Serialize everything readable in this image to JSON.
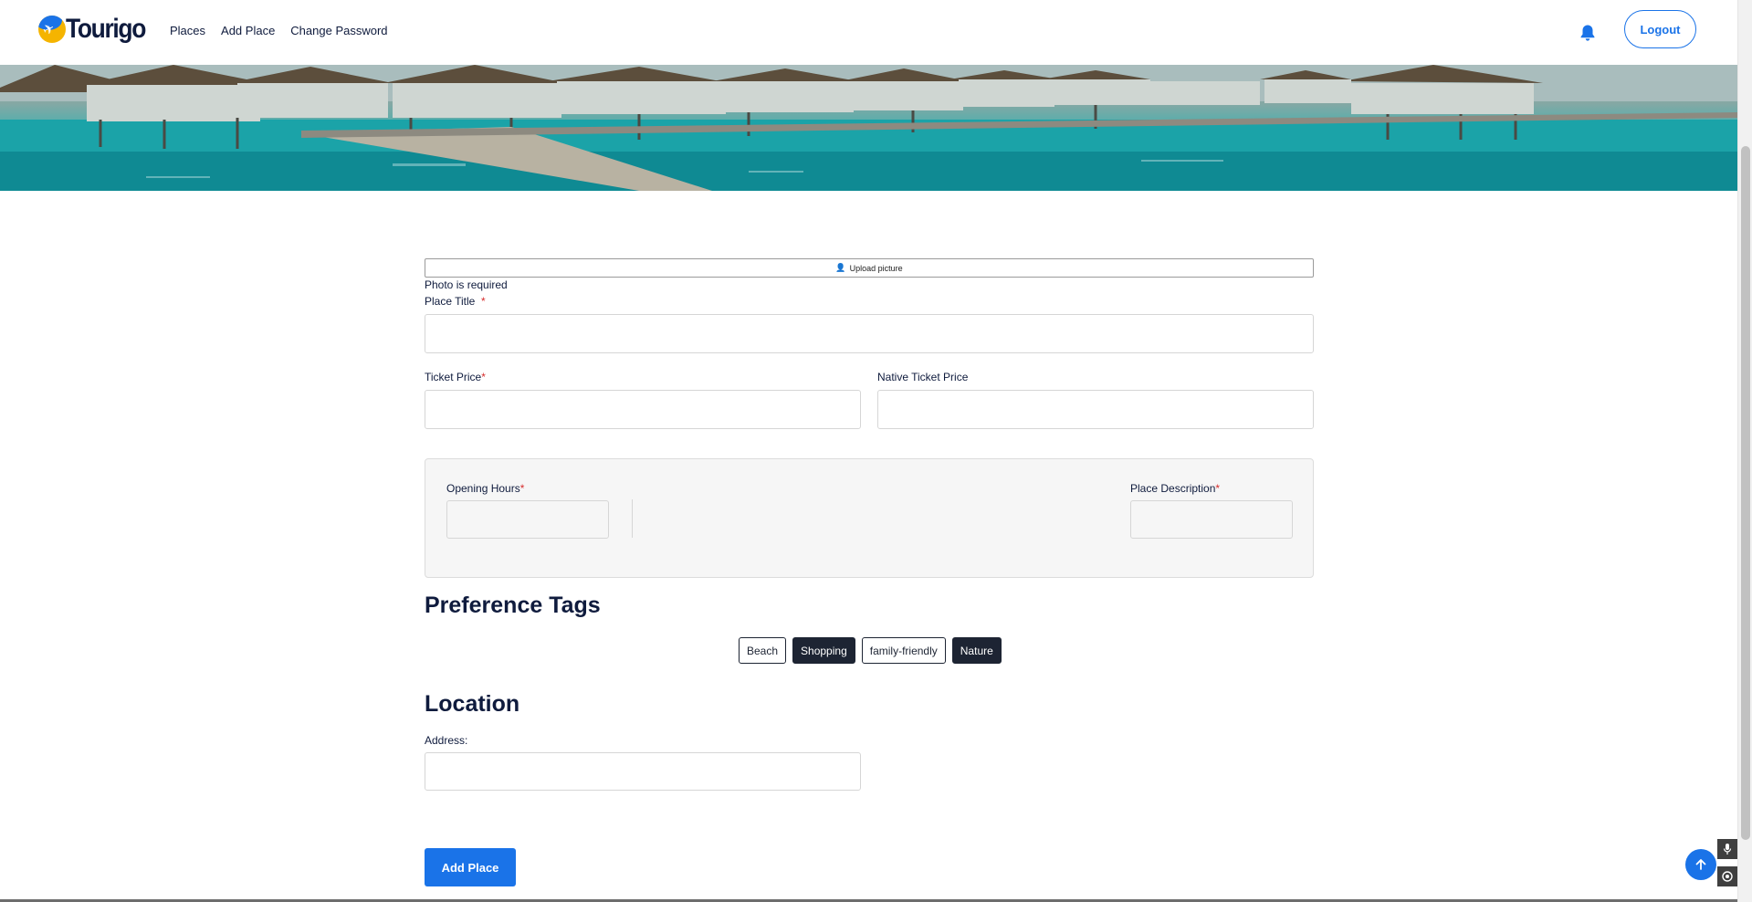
{
  "brand": {
    "name": "Tourigo"
  },
  "nav": {
    "places": "Places",
    "add_place": "Add Place",
    "change_password": "Change Password"
  },
  "header": {
    "logout": "Logout"
  },
  "form": {
    "upload_label": "Upload picture",
    "photo_error": "Photo is required",
    "place_title_label": "Place Title",
    "ticket_price_label": "Ticket Price",
    "native_ticket_price_label": "Native Ticket Price",
    "opening_hours_label": "Opening Hours",
    "place_description_label": "Place Description",
    "required_mark": "*",
    "place_title_value": "",
    "ticket_price_value": "",
    "native_ticket_price_value": "",
    "address_value": ""
  },
  "preferences": {
    "title": "Preference Tags",
    "tags": [
      {
        "label": "Beach",
        "selected": false
      },
      {
        "label": "Shopping",
        "selected": true
      },
      {
        "label": "family-friendly",
        "selected": false
      },
      {
        "label": "Nature",
        "selected": true
      }
    ]
  },
  "location": {
    "title": "Location",
    "address_label": "Address:"
  },
  "actions": {
    "add_place": "Add Place"
  },
  "icons": [
    "logo-plane-icon",
    "bell-icon",
    "upload-user-icon",
    "arrow-up-icon",
    "microphone-icon",
    "target-icon"
  ],
  "colors": {
    "accent": "#1a73e8",
    "dark": "#1d2433",
    "required": "#d62d2d",
    "logo_yellow": "#f5b400"
  }
}
